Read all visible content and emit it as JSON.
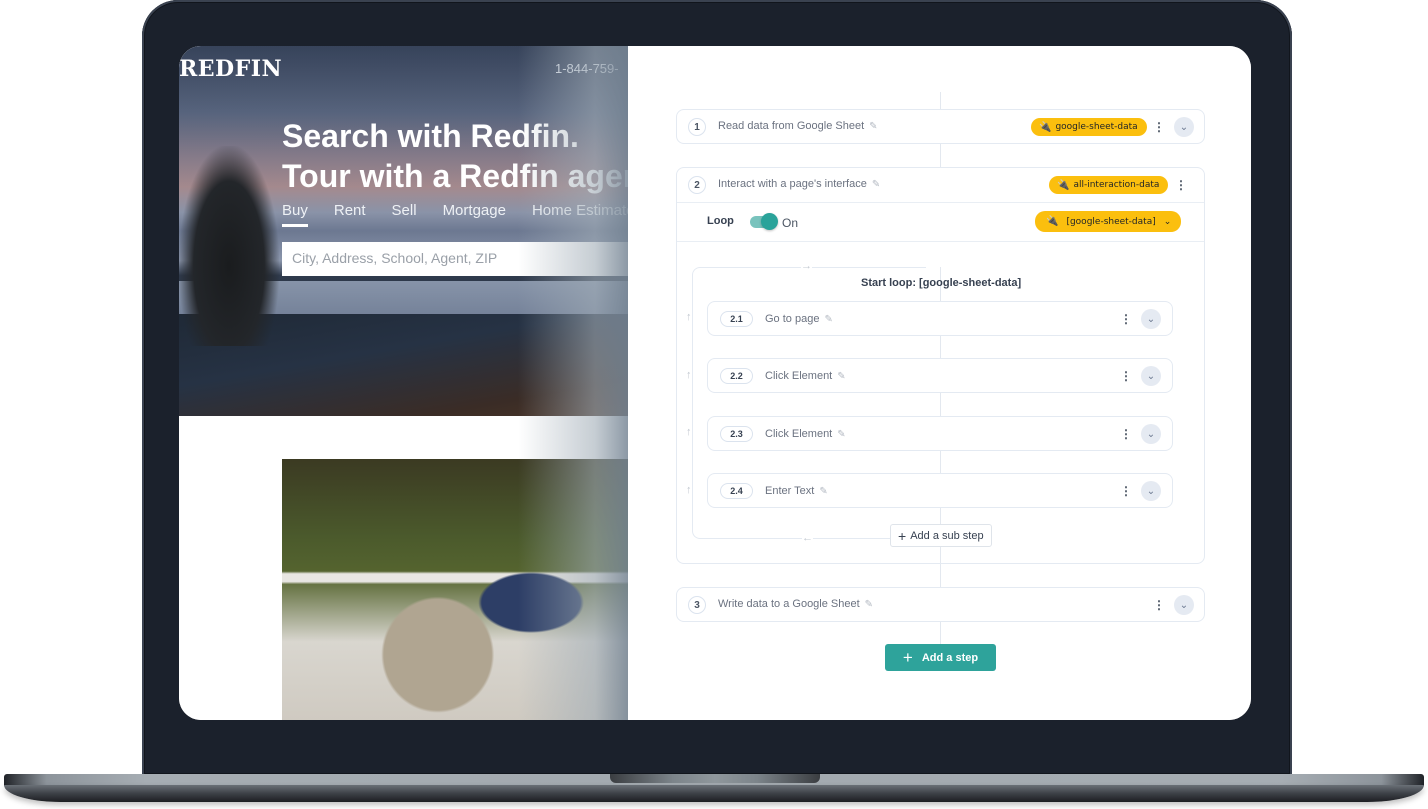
{
  "website": {
    "logo": "REDFIN",
    "phone": "1-844-759-",
    "headline_line1": "Search with Redfin.",
    "headline_line2": "Tour with a Redfin agent",
    "nav_tabs": [
      {
        "label": "Buy",
        "active": true
      },
      {
        "label": "Rent",
        "active": false
      },
      {
        "label": "Sell",
        "active": false
      },
      {
        "label": "Mortgage",
        "active": false
      },
      {
        "label": "Home Estimate",
        "active": false
      }
    ],
    "search_placeholder": "City, Address, School, Agent, ZIP"
  },
  "workflow": {
    "steps": [
      {
        "number": "1",
        "title": "Read data from Google Sheet",
        "output_pill": "google-sheet-data"
      },
      {
        "number": "2",
        "title": "Interact with a page's interface",
        "output_pill": "all-interaction-data"
      },
      {
        "number": "3",
        "title": "Write data to a Google Sheet"
      }
    ],
    "loop": {
      "label": "Loop",
      "toggle_state": "On",
      "enabled": true,
      "source_pill": "[google-sheet-data]",
      "start_label": "Start loop: [google-sheet-data]",
      "sub_steps": [
        {
          "number": "2.1",
          "title": "Go to page"
        },
        {
          "number": "2.2",
          "title": "Click Element"
        },
        {
          "number": "2.3",
          "title": "Click Element"
        },
        {
          "number": "2.4",
          "title": "Enter Text"
        }
      ],
      "add_sub_step_label": "Add a sub step"
    },
    "add_step_label": "Add a step",
    "icons": {
      "plug": "🔌",
      "pencil": "✎",
      "kebab": "⋮",
      "chevron_down": "⌄",
      "arrow_right": "→",
      "arrow_left": "←",
      "arrow_up": "↑",
      "plus": "+"
    },
    "colors": {
      "accent": "#2ea39b",
      "pill": "#fbbf0e"
    }
  }
}
